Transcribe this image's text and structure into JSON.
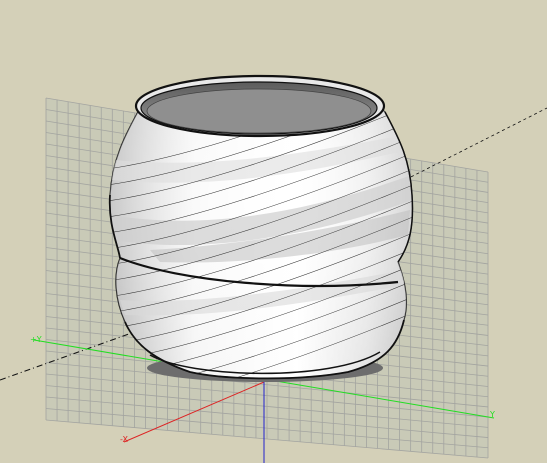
{
  "viewport": {
    "background": "#d4d0b8",
    "grid_color": "#a8a8a8",
    "grid_bg": "#c7c8b5"
  },
  "axes": {
    "y_pos_label": "Y",
    "y_neg_label": "+Y",
    "x_neg_label": "-X",
    "y_color": "#22dd22",
    "x_color": "#dd2222",
    "z_color": "#2222cc"
  },
  "model": {
    "type": "twisted vase surface",
    "fill": "#f2f2f2",
    "opening_fill": "#8a8a8a"
  }
}
